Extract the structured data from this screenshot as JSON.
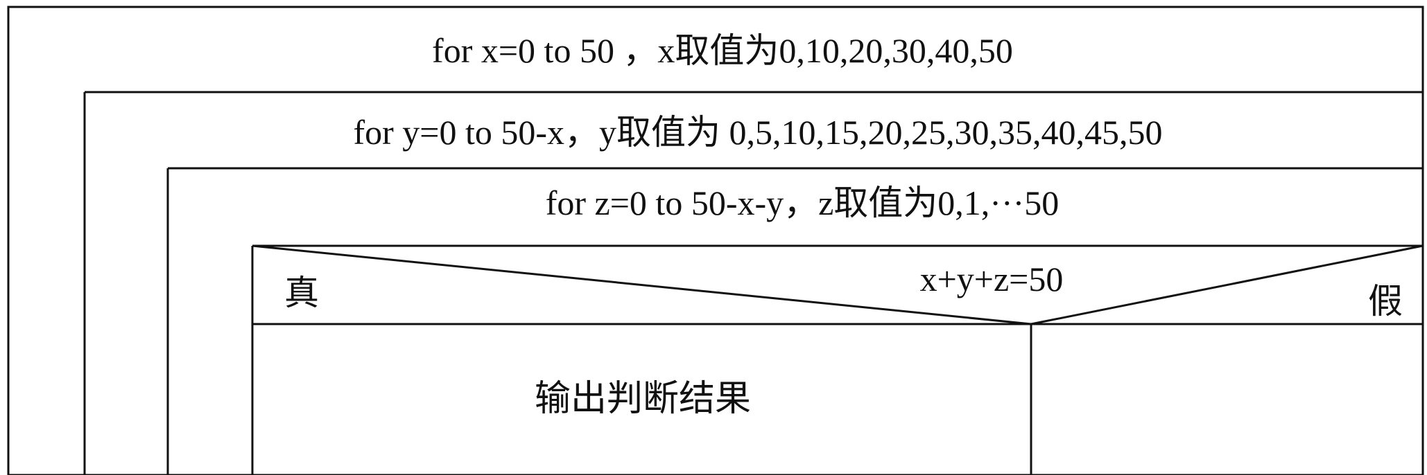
{
  "loops": [
    {
      "label": "for x=0 to 50 ，x取值为0,10,20,30,40,50"
    },
    {
      "label": "for y=0 to 50-x，y取值为 0,5,10,15,20,25,30,35,40,45,50"
    },
    {
      "label": "for z=0 to 50-x-y，z取值为0,1,···50"
    }
  ],
  "decision": {
    "condition": "x+y+z=50",
    "true_label": "真",
    "false_label": "假"
  },
  "branches": {
    "true_action": "输出判断结果",
    "false_action": ""
  },
  "colors": {
    "line": "#111111",
    "background": "#ffffff"
  }
}
